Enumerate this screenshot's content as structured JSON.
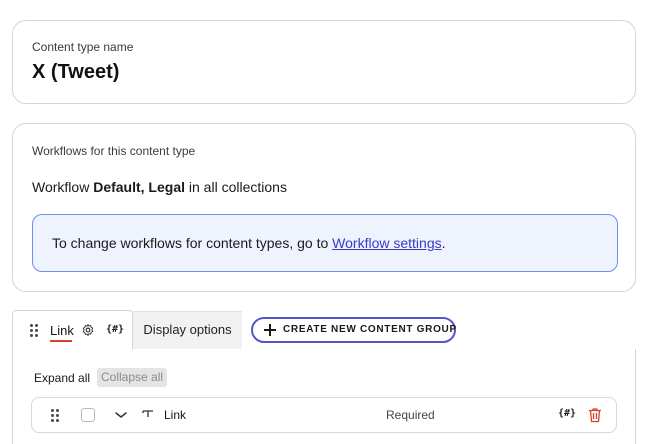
{
  "content_type": {
    "label": "Content type name",
    "name": "X (Tweet)"
  },
  "workflows": {
    "label": "Workflows for this content type",
    "prefix": "Workflow",
    "names": "Default, Legal",
    "suffix": "in all collections",
    "info_text": "To change workflows for content types, go to",
    "info_link": "Workflow settings",
    "info_end": "."
  },
  "tabs": {
    "active_label": "Link",
    "hash_icon_text": "{#}",
    "display_options": "Display options",
    "create_group": "CREATE NEW CONTENT GROUP"
  },
  "controls": {
    "expand_all": "Expand all",
    "collapse_all": "Collapse all"
  },
  "fields": [
    {
      "name": "Link",
      "status": "Required",
      "hash_icon_text": "{#}"
    }
  ],
  "colors": {
    "accent": "#5855cc",
    "tab_underline": "#d9412b",
    "info_bg": "#eef3fd",
    "info_border": "#6d8ff0",
    "link": "#3a39c9",
    "delete": "#d9412b"
  },
  "icons": [
    "drag-handle-icon",
    "gear-icon",
    "hash-icon",
    "plus-icon",
    "chevron-down-icon",
    "text-field-icon",
    "trash-icon"
  ]
}
